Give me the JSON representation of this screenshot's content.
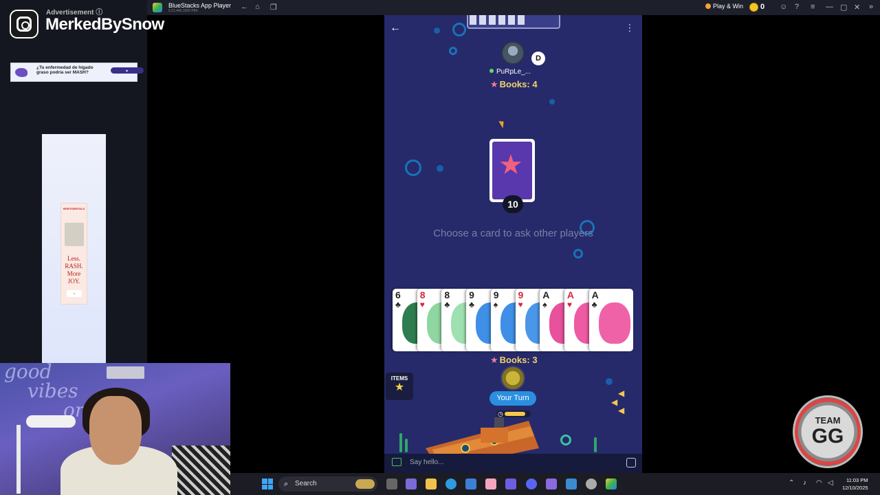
{
  "overlay": {
    "handle": "MerkedBySnow",
    "advertisement_label": "Advertisement ⓘ",
    "ad_banner_text": "¿Tu enfermedad de hígado graso podría ser MASH?",
    "ad_tall_brand": "HEIR ESSENTIALS",
    "ad_tall_slogan": "Less. RASH. More JOY.",
    "team_line1": "TEAM",
    "team_line2": "GG"
  },
  "titlebar": {
    "title": "BlueStacks App Player",
    "version": "5.21.445.1002 P64",
    "play_win": "Play & Win",
    "coins": "0"
  },
  "game": {
    "opponent": {
      "name": "PuRpLe_...",
      "dealer_badge": "D",
      "books": "Books: 4"
    },
    "deck_count": "10",
    "prompt": "Choose a card to ask other players",
    "hand": [
      {
        "rank": "6",
        "suit": "♣",
        "color": "black",
        "art": "#2e7d4f"
      },
      {
        "rank": "8",
        "suit": "♥",
        "color": "red",
        "art": "#8fd6a0"
      },
      {
        "rank": "8",
        "suit": "♣",
        "color": "black",
        "art": "#9fe0b0"
      },
      {
        "rank": "9",
        "suit": "♣",
        "color": "black",
        "art": "#3f8fe6"
      },
      {
        "rank": "9",
        "suit": "♠",
        "color": "black",
        "art": "#3f8fe6"
      },
      {
        "rank": "9",
        "suit": "♥",
        "color": "red",
        "art": "#4a97ea"
      },
      {
        "rank": "A",
        "suit": "♠",
        "color": "black",
        "art": "#e8519b"
      },
      {
        "rank": "A",
        "suit": "♥",
        "color": "red",
        "art": "#ee5aa3"
      },
      {
        "rank": "A",
        "suit": "♣",
        "color": "black",
        "art": "#f062a8"
      }
    ],
    "my_books": "Books: 3",
    "items_label": "ITEMS",
    "your_turn": "Your Turn",
    "chat_placeholder": "Say hello..."
  },
  "taskbar": {
    "search": "Search",
    "time": "11:03 PM",
    "date": "12/10/2025"
  }
}
